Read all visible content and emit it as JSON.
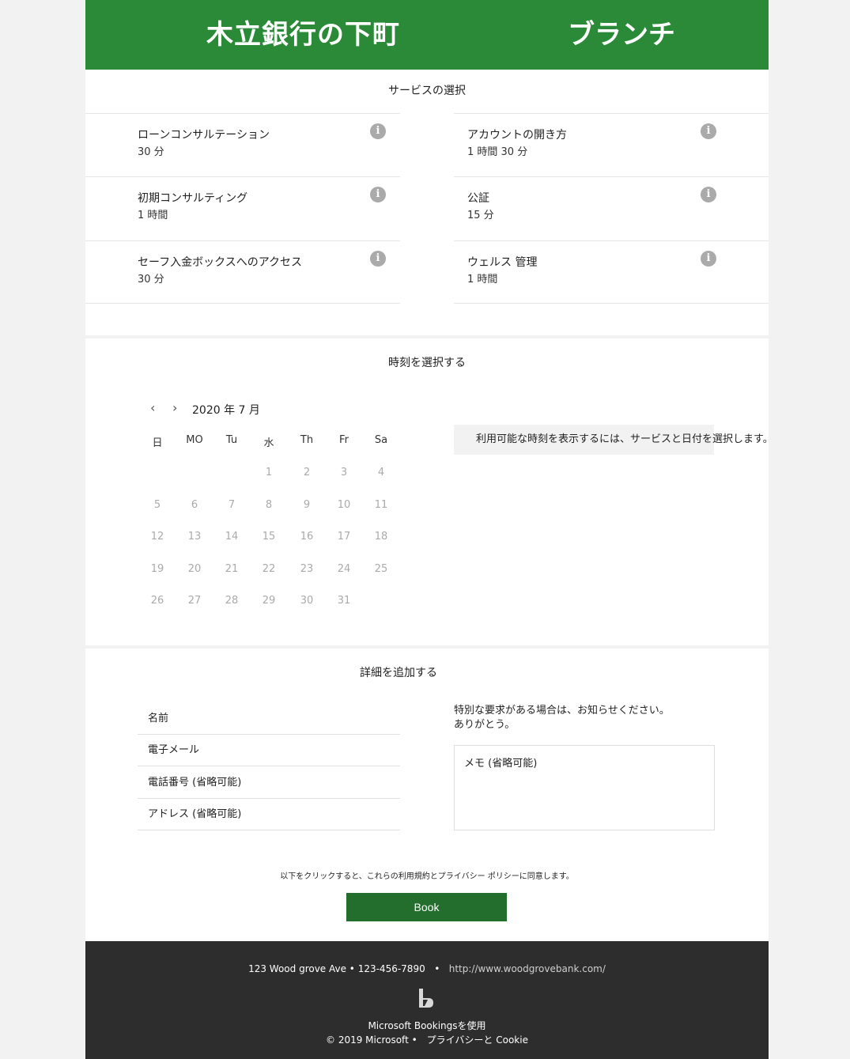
{
  "header": {
    "bank_name": "木立銀行の下町",
    "branch": "ブランチ"
  },
  "services": {
    "title": "サービスの選択",
    "items": [
      {
        "name": "ローンコンサルテーション",
        "duration": "30 分"
      },
      {
        "name": "アカウントの開き方",
        "duration": "1 時間 30 分"
      },
      {
        "name": "初期コンサルティング",
        "duration": "1 時間"
      },
      {
        "name": "公証",
        "duration": "15 分"
      },
      {
        "name": "セーフ入金ボックスへのアクセス",
        "duration": "30 分"
      },
      {
        "name": "ウェルス 管理",
        "duration": "1 時間"
      }
    ],
    "info_glyph": "i"
  },
  "time": {
    "title": "時刻を選択する",
    "prev": "‹",
    "next": "›",
    "month_label": "2020 年 7 月",
    "weekdays": [
      "日",
      "MO",
      "Tu",
      "水",
      "Th",
      "Fr",
      "Sa"
    ],
    "days": [
      "1",
      "2",
      "3",
      "4",
      "5",
      "6",
      "7",
      "8",
      "9",
      "10",
      "11",
      "12",
      "13",
      "14",
      "15",
      "16",
      "17",
      "18",
      "19",
      "20",
      "21",
      "22",
      "23",
      "24",
      "25",
      "26",
      "27",
      "28",
      "29",
      "30",
      "31"
    ],
    "first_weekday_index": 3,
    "slot_message": "利用可能な時刻を表示するには、サービスと日付を選択します。"
  },
  "details": {
    "title": "詳細を追加する",
    "fields": [
      "名前",
      "電子メール",
      "電話番号 (省略可能)",
      "アドレス (省略可能)"
    ],
    "hint_line1": "特別な要求がある場合は、お知らせください。",
    "hint_line2": "ありがとう。",
    "notes_placeholder": "メモ (省略可能)"
  },
  "terms": "以下をクリックすると、これらの利用規約とプライバシー ポリシーに同意します。",
  "book_label": "Book",
  "footer": {
    "address": "123 Wood grove Ave • 123-456-7890",
    "separator": "•",
    "url": "http://www.woodgrovebank.com/",
    "powered": "Microsoft Bookingsを使用",
    "copyright": "© 2019 Microsoft •　プライバシーと Cookie",
    "logo_icon": "bookings-logo-icon"
  },
  "colors": {
    "brand_green": "#2b8a37",
    "button_green": "#236e2c",
    "footer_bg": "#2d2d2d"
  }
}
